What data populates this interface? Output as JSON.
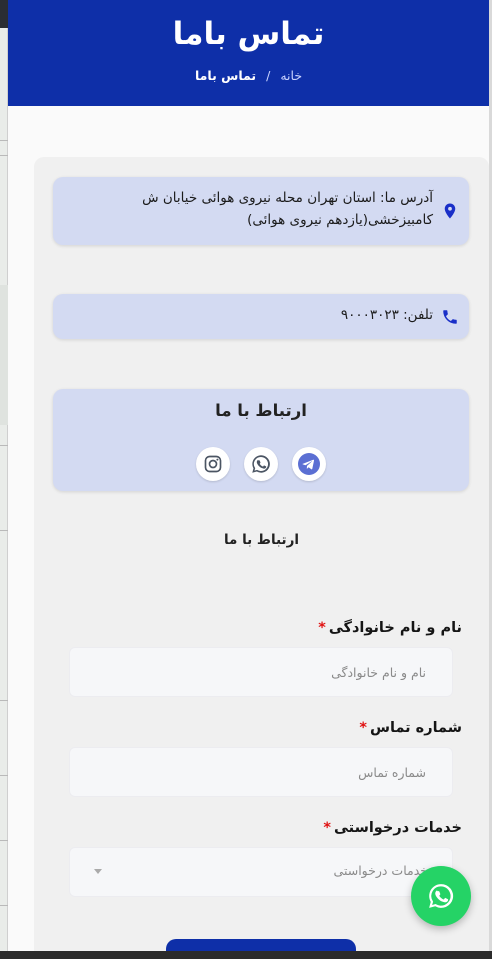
{
  "hero": {
    "title": "تماس باما",
    "breadcrumb": {
      "home": "خانه",
      "separator": "/",
      "current": "تماس باما"
    }
  },
  "contact_info": {
    "address": "آدرس ما: استان تهران محله نیروی هوائی خیابان ش کامبیزخشی(یازدهم نیروی هوائی)",
    "phone": "تلفن: ۹۰۰۰۳۰۲۳",
    "address_icon": "map-pin-icon",
    "phone_icon": "phone-icon"
  },
  "social": {
    "title": "ارتباط با ما",
    "icons": [
      "telegram-icon",
      "whatsapp-icon",
      "instagram-icon"
    ]
  },
  "form": {
    "title": "ارتباط با ما",
    "name_label": "نام و نام خانوادگی",
    "name_placeholder": "نام و نام خانوادگی",
    "phone_label": "شماره تماس",
    "phone_placeholder": "شماره تماس",
    "service_label": "خدمات درخواستی",
    "service_selected": "خدمات درخواستی",
    "required_mark": "*"
  },
  "colors": {
    "primary": "#0e2fa8",
    "card_blue": "#d3daf2",
    "required": "#e01010",
    "whatsapp": "#25d366"
  },
  "floating": {
    "whatsapp_icon": "whatsapp-icon"
  }
}
